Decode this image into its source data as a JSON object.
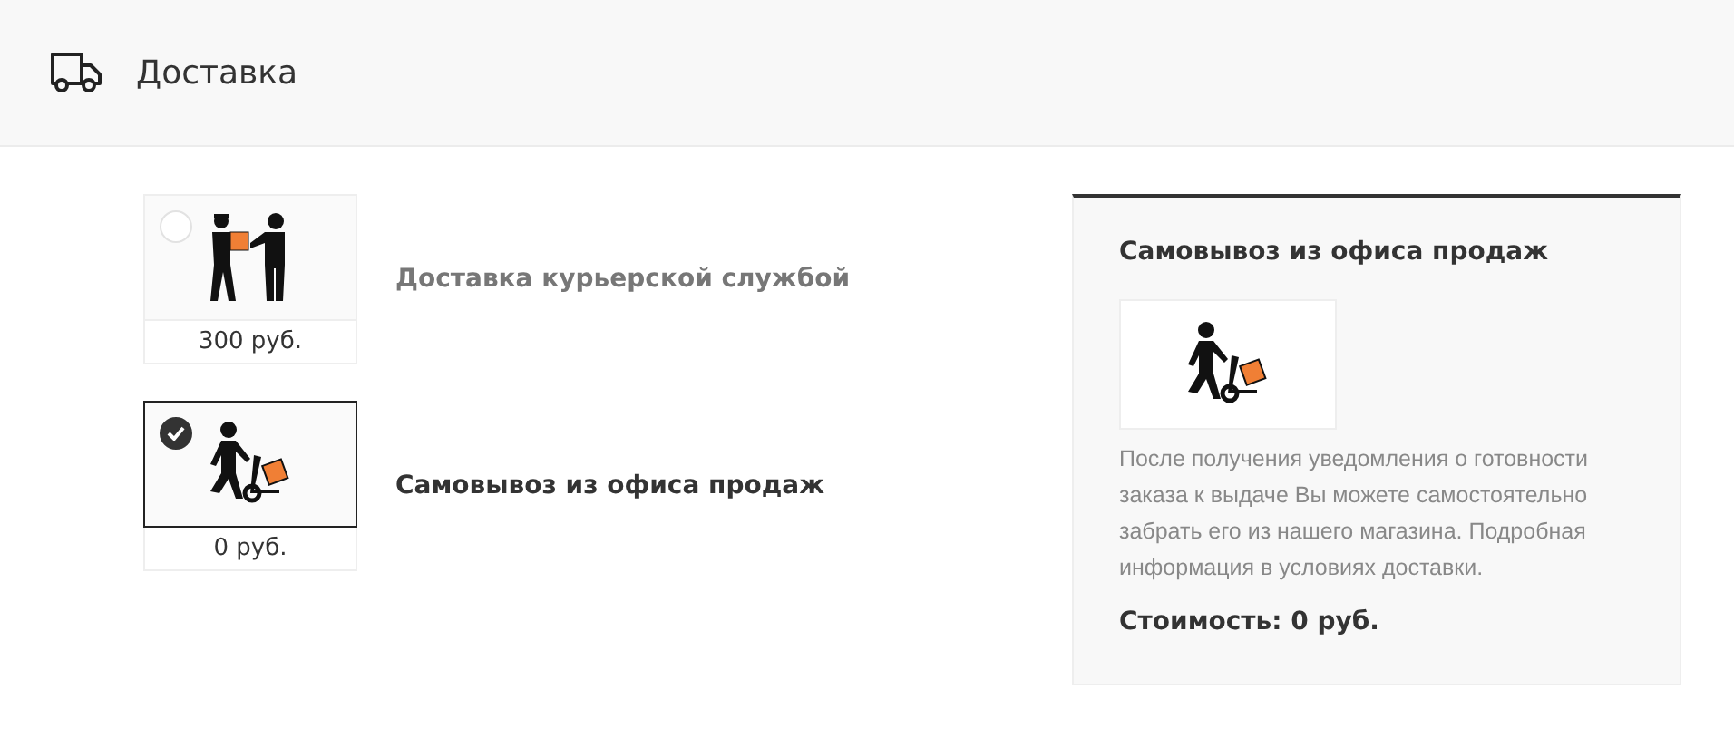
{
  "header": {
    "title": "Доставка"
  },
  "options": [
    {
      "name": "Доставка курьерской службой",
      "price": "300 руб.",
      "selected": false,
      "kind": "courier"
    },
    {
      "name": "Самовывоз из офиса продаж",
      "price": "0 руб.",
      "selected": true,
      "kind": "pickup"
    }
  ],
  "details": {
    "title": "Самовывоз из офиса продаж",
    "kind": "pickup",
    "description": "После получения уведомления о готовности заказа к выдаче Вы можете самостоятельно забрать его из нашего магазина. Подробная информация в условиях доставки.",
    "cost": "Стоимость: 0 руб."
  }
}
